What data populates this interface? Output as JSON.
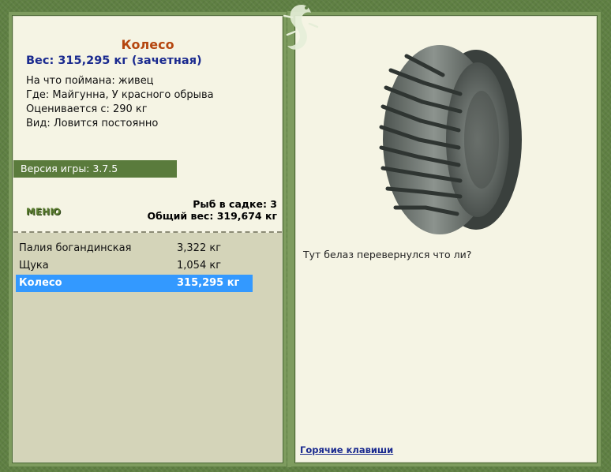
{
  "fish": {
    "name": "Колесо",
    "weight_line": "Вес: 315,295 кг (зачетная)",
    "bait": "На что поймана: живец",
    "location": "Где: Майгунна, У красного обрыва",
    "valued_from": "Оценивается с: 290 кг",
    "type": "Вид: Ловится постоянно",
    "description": "Тут белаз перевернулся что ли?"
  },
  "game_version": "Версия игры: 3.7.5",
  "menu_label": "МЕНЮ",
  "stats": {
    "fish_in_keepnet": "Рыб в садке: 3",
    "total_weight": "Общий вес: 319,674 кг"
  },
  "catch_list": [
    {
      "name": "Палия богандинская",
      "weight": "3,322 кг"
    },
    {
      "name": "Щука",
      "weight": "1,054 кг"
    },
    {
      "name": "Колесо",
      "weight": "315,295 кг",
      "selected": true
    }
  ],
  "hotkeys_label": "Горячие клавиши",
  "icons": {
    "logo": "lizard-icon",
    "picture": "tire-image"
  },
  "colors": {
    "background": "#5f8043",
    "panel": "#f5f4e4",
    "list_bg": "#d4d4b9",
    "version_bar": "#5a7b3c",
    "selected": "#3399ff",
    "title": "#b5460f",
    "weight": "#1a2a8f"
  }
}
